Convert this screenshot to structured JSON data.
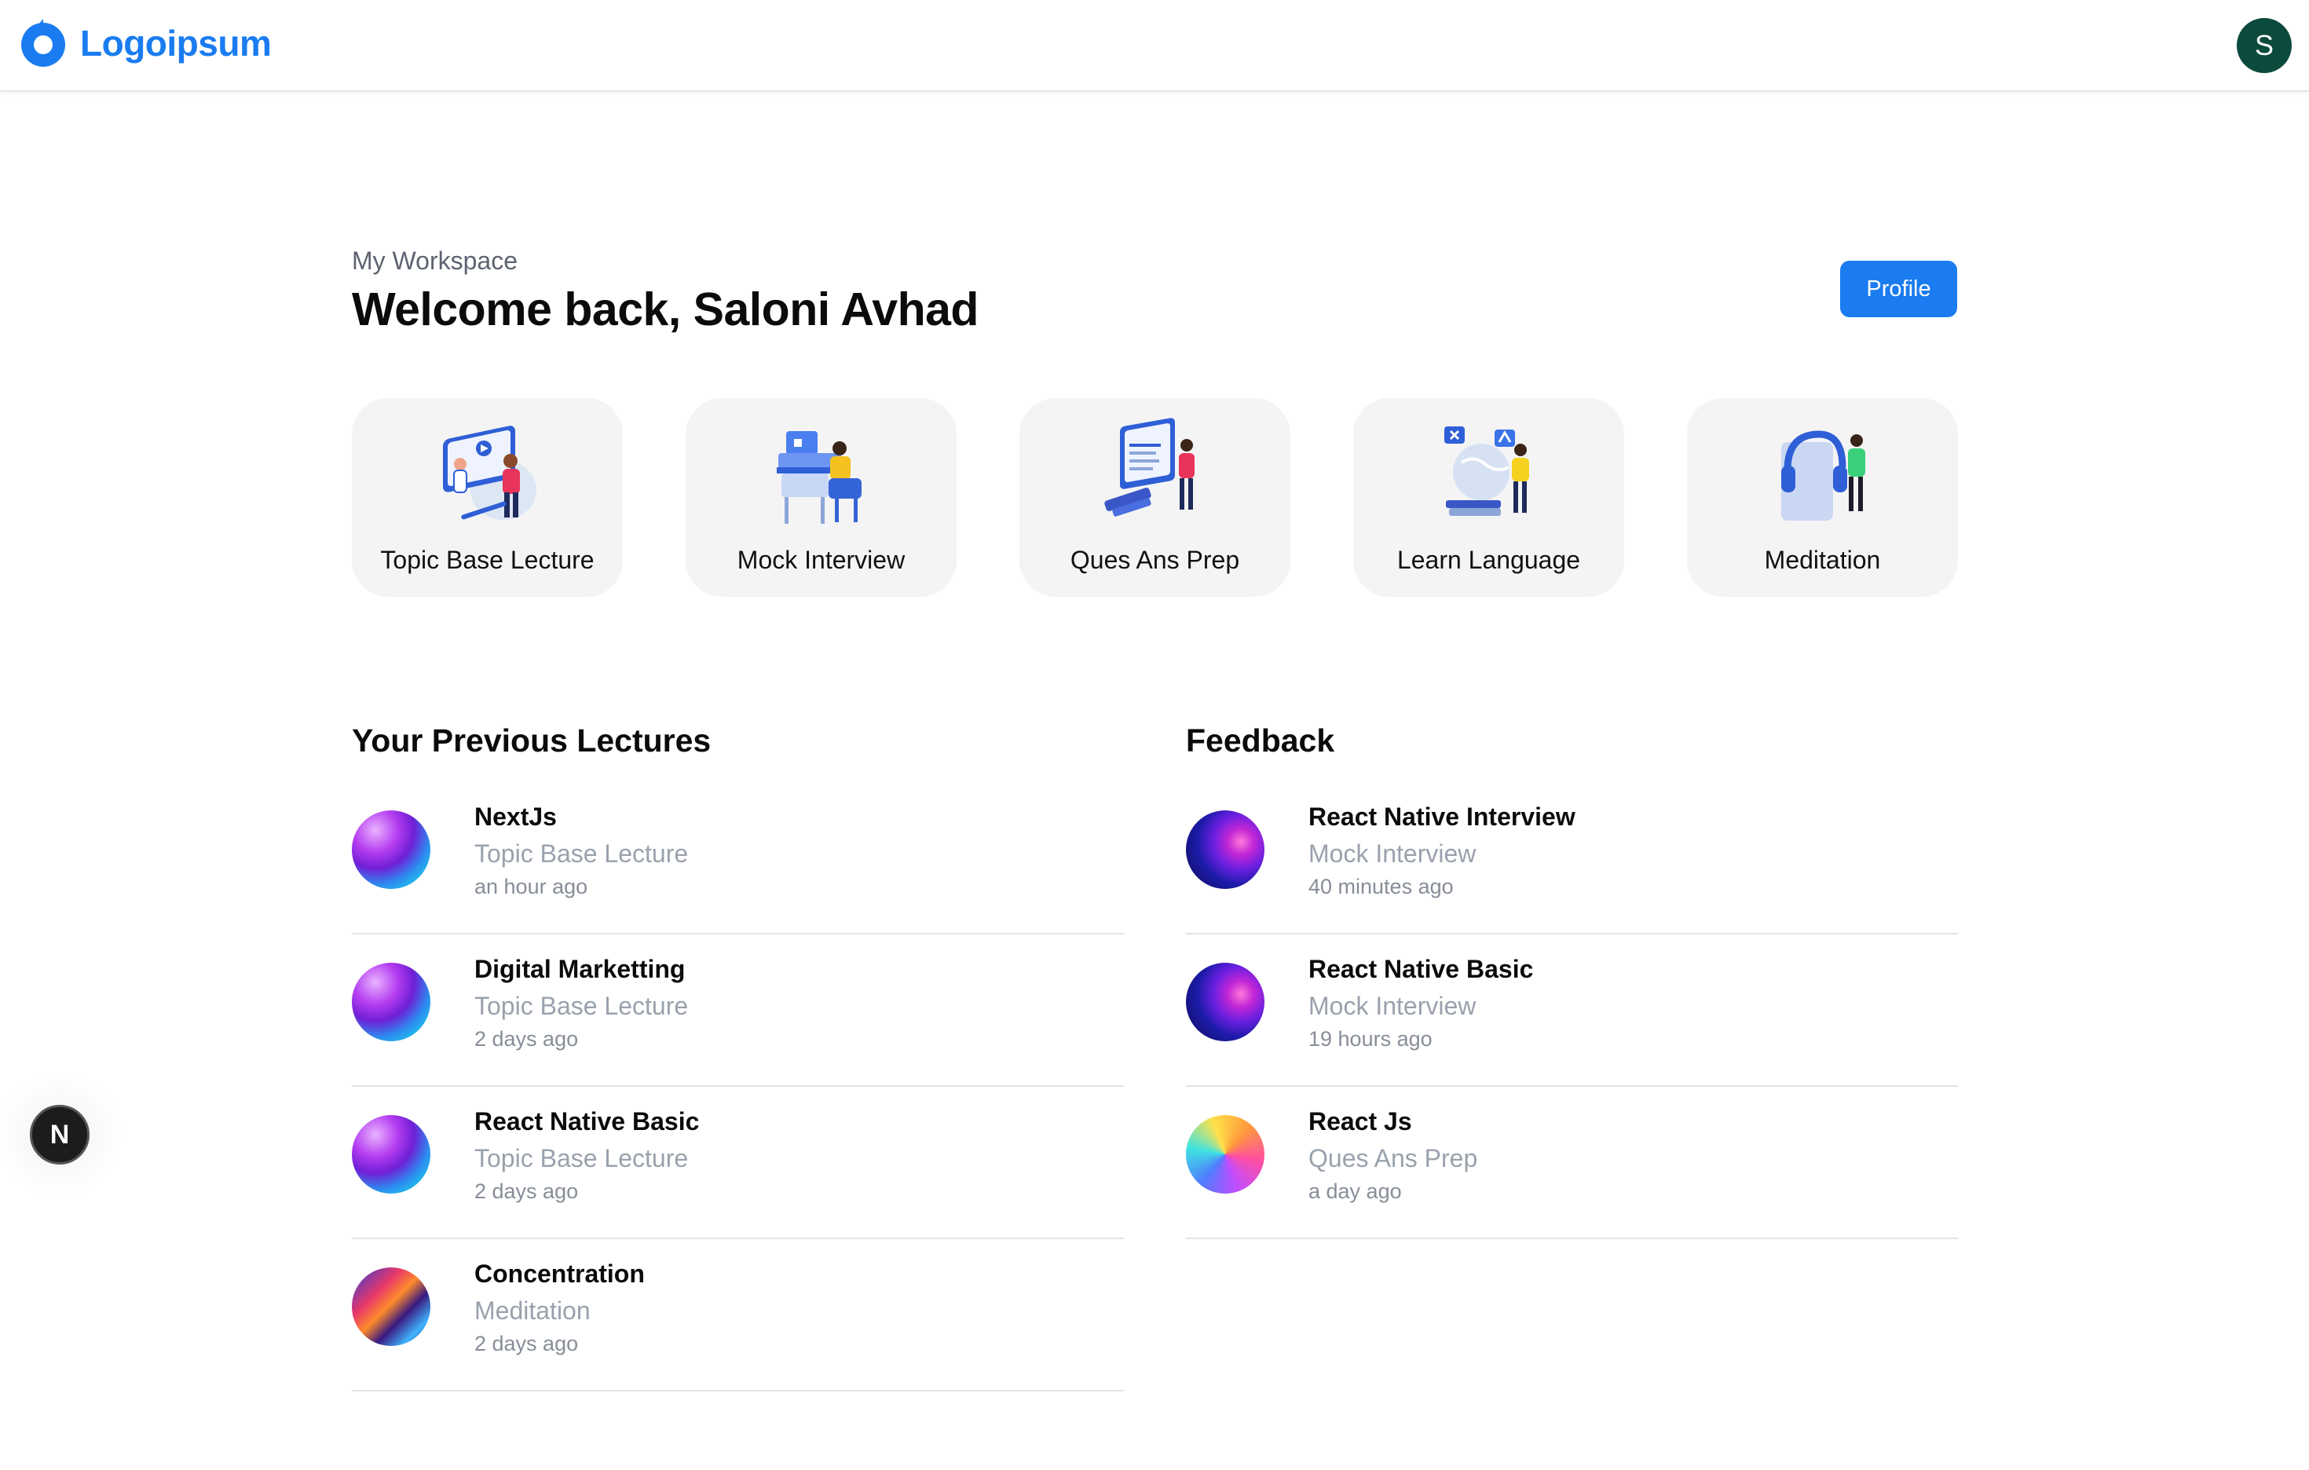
{
  "header": {
    "logo_text": "Logoipsum",
    "avatar_initial": "S"
  },
  "welcome": {
    "workspace_label": "My Workspace",
    "title": "Welcome back, Saloni Avhad",
    "profile_button": "Profile"
  },
  "categories": [
    {
      "label": "Topic Base Lecture",
      "icon": "lecture-illustration"
    },
    {
      "label": "Mock Interview",
      "icon": "interview-illustration"
    },
    {
      "label": "Ques Ans Prep",
      "icon": "qa-prep-illustration"
    },
    {
      "label": "Learn Language",
      "icon": "language-illustration"
    },
    {
      "label": "Meditation",
      "icon": "meditation-illustration"
    }
  ],
  "previous_lectures": {
    "title": "Your Previous Lectures",
    "items": [
      {
        "name": "NextJs",
        "type": "Topic Base Lecture",
        "time": "an hour ago"
      },
      {
        "name": "Digital Marketting",
        "type": "Topic Base Lecture",
        "time": "2 days ago"
      },
      {
        "name": "React Native Basic",
        "type": "Topic Base Lecture",
        "time": "2 days ago"
      },
      {
        "name": "Concentration",
        "type": "Meditation",
        "time": "2 days ago"
      }
    ]
  },
  "feedback": {
    "title": "Feedback",
    "items": [
      {
        "name": "React Native Interview",
        "type": "Mock Interview",
        "time": "40 minutes ago"
      },
      {
        "name": "React Native Basic",
        "type": "Mock Interview",
        "time": "19 hours ago"
      },
      {
        "name": "React Js",
        "type": "Ques Ans Prep",
        "time": "a day ago"
      }
    ]
  },
  "floating_badge": "N",
  "colors": {
    "brand": "#1a7cf0",
    "avatar": "#0b4a3c",
    "card_bg": "#f4f4f4",
    "muted_text": "#9aa1ad"
  }
}
